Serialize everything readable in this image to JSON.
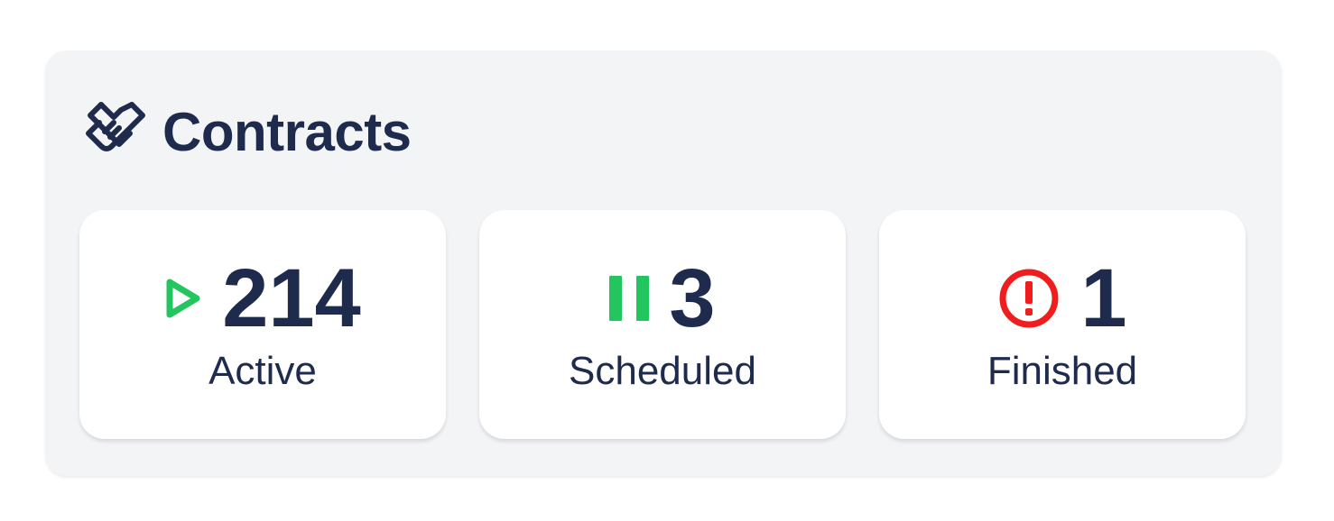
{
  "widget": {
    "title": "Contracts",
    "icon": "handshake-icon"
  },
  "stats": [
    {
      "value": "214",
      "label": "Active",
      "icon": "play-icon",
      "color": "#22c55e"
    },
    {
      "value": "3",
      "label": "Scheduled",
      "icon": "pause-icon",
      "color": "#22c55e"
    },
    {
      "value": "1",
      "label": "Finished",
      "icon": "alert-circle-icon",
      "color": "#ef1d1d"
    }
  ],
  "colors": {
    "text": "#1f2b4d",
    "card_background": "#f3f4f6",
    "tile_background": "#ffffff"
  }
}
